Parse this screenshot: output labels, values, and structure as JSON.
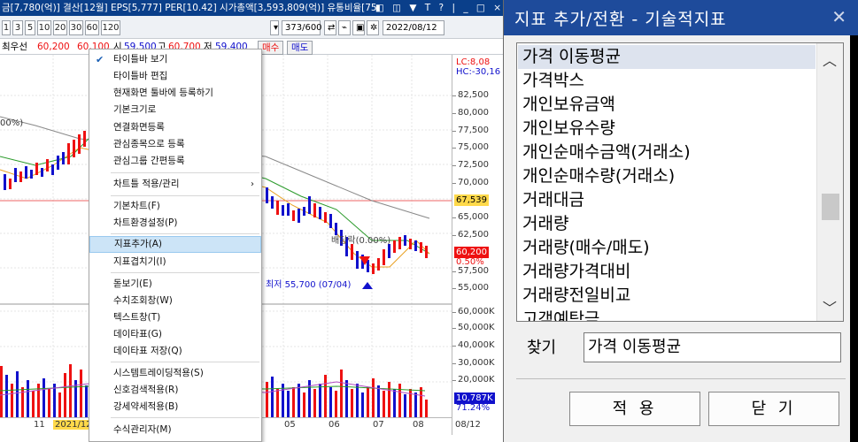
{
  "topbar": {
    "text": "금[7,780(억)] 결산[12월] EPS[5,777] PER[10.42] 시가총액[3,593,809(억)] 유통비율[75.",
    "icons": "◧ ◫ ▼ T ? | _ □ ×"
  },
  "toolbar": {
    "periods": [
      "1",
      "3",
      "5",
      "10",
      "20",
      "30",
      "60",
      "120"
    ],
    "count": "373/600",
    "date": "2022/08/12"
  },
  "infobar": {
    "prefix": "최우선",
    "v1": "60,200",
    "v2": "60,100",
    "open_label": "시",
    "open": "59,500",
    "high_label": "고",
    "high": "60,700",
    "low_label": "저",
    "low": "59,400",
    "buy": "매수",
    "sell": "매도"
  },
  "chart": {
    "lc": "LC:8,08",
    "hc": "HC:-30,16",
    "price_axis": [
      "82,500",
      "80,000",
      "77,500",
      "75,000",
      "72,500",
      "70,000",
      "65,000",
      "62,500",
      "57,500",
      "55,000"
    ],
    "price_tag": "67,539",
    "current_price": "60,200",
    "change_pct": "0.50%",
    "vol_axis": [
      "60,000K",
      "50,000K",
      "40,000K",
      "30,000K",
      "20,000K"
    ],
    "vol_tag": "10,787K",
    "vol_pct": "71.24%",
    "pct_left": "00%)",
    "annot_mid": "배당락(0.00%)",
    "annot_low": "최저 55,700 (07/04)",
    "x_labels": [
      "11",
      "2021/12",
      "05",
      "06",
      "07",
      "08",
      "08/12"
    ]
  },
  "context_menu": {
    "items": [
      "타이틀바 보기",
      "타이틀바 편집",
      "현재화면 툴바에 등록하기",
      "기본크기로",
      "연결화면등록",
      "관심종목으로 등록",
      "관심그룹 간편등록",
      "차트틀 적용/관리",
      "기본차트(F)",
      "차트환경설정(P)",
      "지표추가(A)",
      "지표겹치기(I)",
      "돋보기(E)",
      "수치조회창(W)",
      "텍스트창(T)",
      "데이타표(G)",
      "데이타표 저장(Q)",
      "시스템트레이딩적용(S)",
      "신호검색적용(R)",
      "강세약세적용(B)",
      "수식관리자(M)"
    ]
  },
  "dialog": {
    "title": "지표 추가/전환 - 기술적지표",
    "items": [
      "가격 이동평균",
      "가격박스",
      "개인보유금액",
      "개인보유수량",
      "개인순매수금액(거래소)",
      "개인순매수량(거래소)",
      "거래대금",
      "거래량",
      "거래량(매수/매도)",
      "거래량가격대비",
      "거래량전일비교",
      "고객예탁금"
    ],
    "find_label": "찾기",
    "find_value": "가격 이동평균",
    "apply": "적 용",
    "close": "닫 기"
  },
  "colors": {
    "title_bar": "#1e4b9b",
    "up_candle": "#e11111",
    "down_candle": "#1111cc",
    "highlight": "#cce4f7"
  }
}
